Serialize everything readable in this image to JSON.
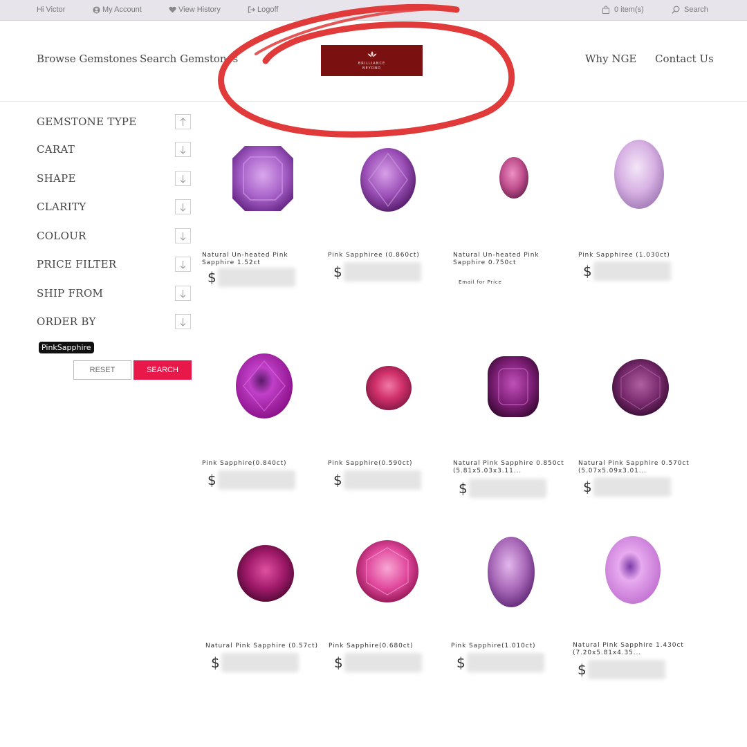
{
  "topbar": {
    "greeting": "Hi Victor",
    "my_account": "My Account",
    "view_history": "View History",
    "logoff": "Logoff",
    "cart": "0 item(s)",
    "search": "Search"
  },
  "nav": {
    "browse": "Browse Gemstones",
    "search": "Search Gemstones",
    "why": "Why NGE",
    "contact": "Contact Us",
    "logo_line1": "BRILLIANCE",
    "logo_line2": "BEYOND",
    "logo_color": "#7a1010"
  },
  "annotation_color": "#e03a3a",
  "filters": [
    {
      "label": "GEMSTONE TYPE",
      "arrow": "up"
    },
    {
      "label": "CARAT",
      "arrow": "down"
    },
    {
      "label": "SHAPE",
      "arrow": "down"
    },
    {
      "label": "CLARITY",
      "arrow": "down"
    },
    {
      "label": "COLOUR",
      "arrow": "down"
    },
    {
      "label": "PRICE FILTER",
      "arrow": "down"
    },
    {
      "label": "SHIP FROM",
      "arrow": "down"
    },
    {
      "label": "ORDER BY",
      "arrow": "down"
    }
  ],
  "active_tag": "PinkSapphire",
  "buttons": {
    "reset": "RESET",
    "search": "SEARCH",
    "search_color": "#e8184a"
  },
  "currency": "$",
  "products": [
    {
      "name": "Natural Un-heated Pink Sapphire 1.52ct",
      "price": "blurred",
      "shape": "octagon",
      "color": "#a760c8"
    },
    {
      "name": "Pink Sapphiree (0.860ct)",
      "price": "blurred",
      "shape": "oval",
      "color": "#9b4fb7"
    },
    {
      "name": "Natural Un-heated Pink Sapphire 0.750ct",
      "price": "Email for Price",
      "shape": "oval-small",
      "color": "#c0508f"
    },
    {
      "name": "Pink Sapphiree (1.030ct)",
      "price": "blurred",
      "shape": "oval-tall",
      "color": "#d7b1e3"
    },
    {
      "name": "Pink Sapphire(0.840ct)",
      "price": "blurred",
      "shape": "oval",
      "color": "#b01fb0"
    },
    {
      "name": "Pink Sapphire(0.590ct)",
      "price": "blurred",
      "shape": "round-small",
      "color": "#d0306a"
    },
    {
      "name": "Natural Pink Sapphire 0.850ct (5.81x5.03x3.11...",
      "price": "blurred",
      "shape": "cushion",
      "color": "#7e1f77"
    },
    {
      "name": "Natural Pink Sapphire 0.570ct (5.07x5.09x3.01...",
      "price": "blurred",
      "shape": "round",
      "color": "#7a2b6f"
    },
    {
      "name": "Natural Pink Sapphire (0.57ct)",
      "price": "blurred",
      "shape": "round",
      "color": "#a01a6a"
    },
    {
      "name": "Pink Sapphire(0.680ct)",
      "price": "blurred",
      "shape": "round",
      "color": "#e0479c"
    },
    {
      "name": "Pink Sapphire(1.010ct)",
      "price": "blurred",
      "shape": "oval-tall",
      "color": "#a868b8"
    },
    {
      "name": "Natural Pink Sapphire 1.430ct (7.20x5.81x4.35...",
      "price": "blurred",
      "shape": "oval",
      "color": "#d68be0"
    }
  ]
}
